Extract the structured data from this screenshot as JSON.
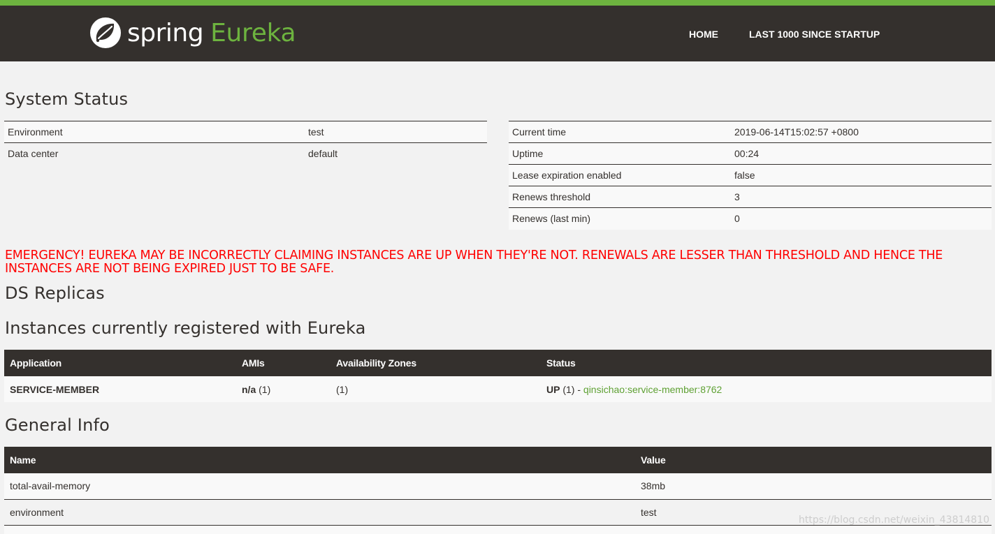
{
  "header": {
    "brand_spring": "spring",
    "brand_eureka": "Eureka",
    "nav_home": "HOME",
    "nav_last": "LAST 1000 SINCE STARTUP",
    "accent_color": "#6db33f",
    "bar_color": "#34302d"
  },
  "system_status": {
    "title": "System Status",
    "left": [
      {
        "label": "Environment",
        "value": "test"
      },
      {
        "label": "Data center",
        "value": "default"
      }
    ],
    "right": [
      {
        "label": "Current time",
        "value": "2019-06-14T15:02:57 +0800"
      },
      {
        "label": "Uptime",
        "value": "00:24"
      },
      {
        "label": "Lease expiration enabled",
        "value": "false"
      },
      {
        "label": "Renews threshold",
        "value": "3"
      },
      {
        "label": "Renews (last min)",
        "value": "0"
      }
    ]
  },
  "emergency": "EMERGENCY! EUREKA MAY BE INCORRECTLY CLAIMING INSTANCES ARE UP WHEN THEY'RE NOT. RENEWALS ARE LESSER THAN THRESHOLD AND HENCE THE INSTANCES ARE NOT BEING EXPIRED JUST TO BE SAFE.",
  "ds_replicas": {
    "title": "DS Replicas"
  },
  "instances": {
    "title": "Instances currently registered with Eureka",
    "columns": [
      "Application",
      "AMIs",
      "Availability Zones",
      "Status"
    ],
    "rows": [
      {
        "application": "SERVICE-MEMBER",
        "amis_bold": "n/a",
        "amis_count": "(1)",
        "zones": "(1)",
        "status_bold": "UP",
        "status_count": "(1) -",
        "status_link": "qinsichao:service-member:8762"
      }
    ]
  },
  "general_info": {
    "title": "General Info",
    "columns": [
      "Name",
      "Value"
    ],
    "rows": [
      {
        "name": "total-avail-memory",
        "value": "38mb"
      },
      {
        "name": "environment",
        "value": "test"
      }
    ]
  },
  "watermark": "https://blog.csdn.net/weixin_43814810"
}
